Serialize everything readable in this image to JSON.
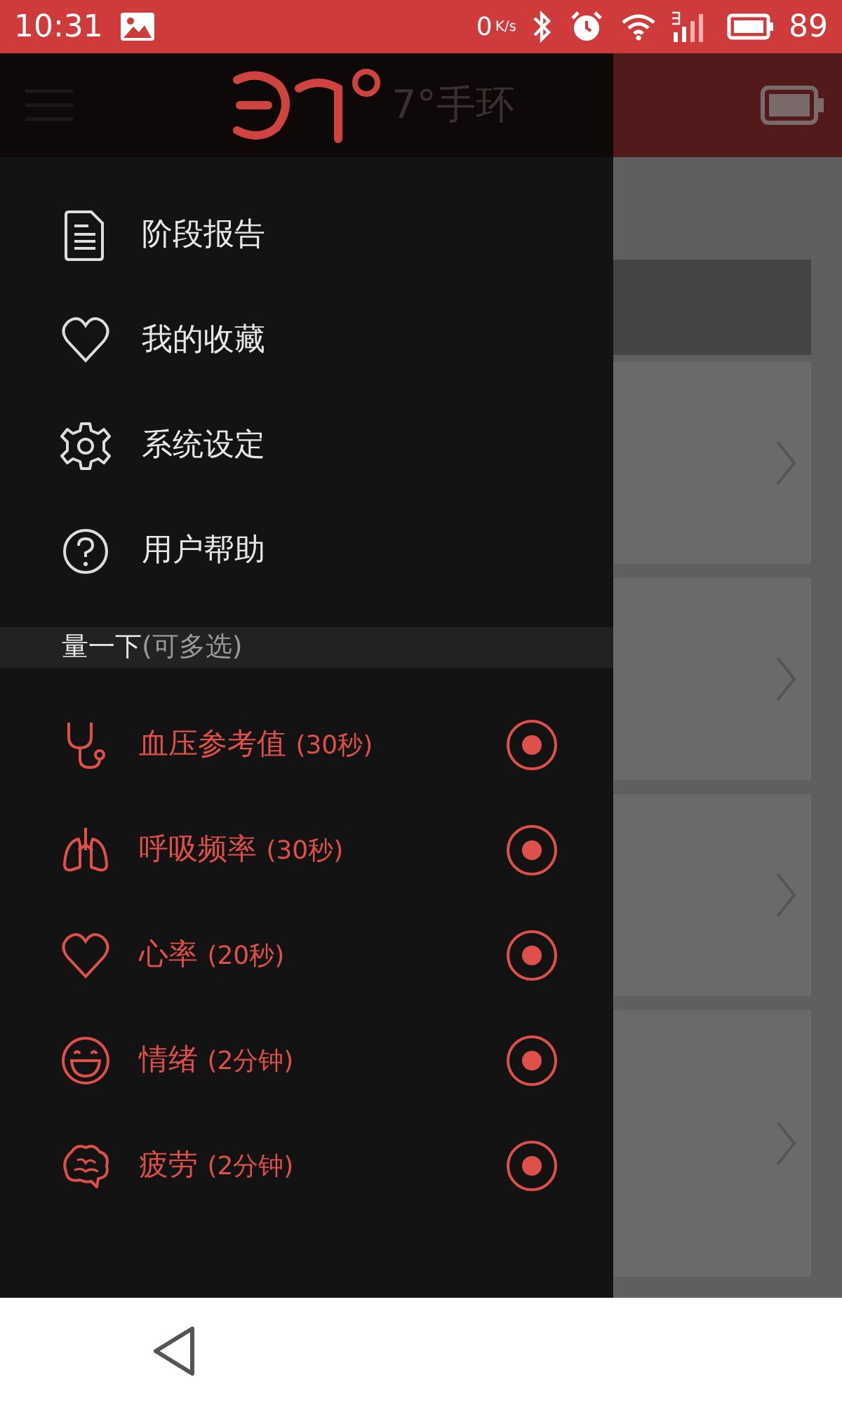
{
  "status_bar": {
    "time": "10:31",
    "net_speed": "0",
    "net_unit": "K/s",
    "battery": "89"
  },
  "header": {
    "title": "7°手环"
  },
  "drawer": {
    "menu": [
      {
        "label": "阶段报告",
        "kind": "report"
      },
      {
        "label": "我的收藏",
        "kind": "heart"
      },
      {
        "label": "系统设定",
        "kind": "gear"
      },
      {
        "label": "用户帮助",
        "kind": "help"
      }
    ],
    "section": {
      "title": "量一下",
      "hint": "(可多选)"
    },
    "measures": [
      {
        "name": "血压参考值",
        "duration": "(30秒)",
        "kind": "stethoscope",
        "selected": true
      },
      {
        "name": "呼吸频率",
        "duration": "(30秒)",
        "kind": "lungs",
        "selected": true
      },
      {
        "name": "心率",
        "duration": "(20秒)",
        "kind": "heart",
        "selected": true
      },
      {
        "name": "情绪",
        "duration": "(2分钟)",
        "kind": "smile",
        "selected": true
      },
      {
        "name": "疲劳",
        "duration": "(2分钟)",
        "kind": "brain",
        "selected": true
      }
    ]
  }
}
